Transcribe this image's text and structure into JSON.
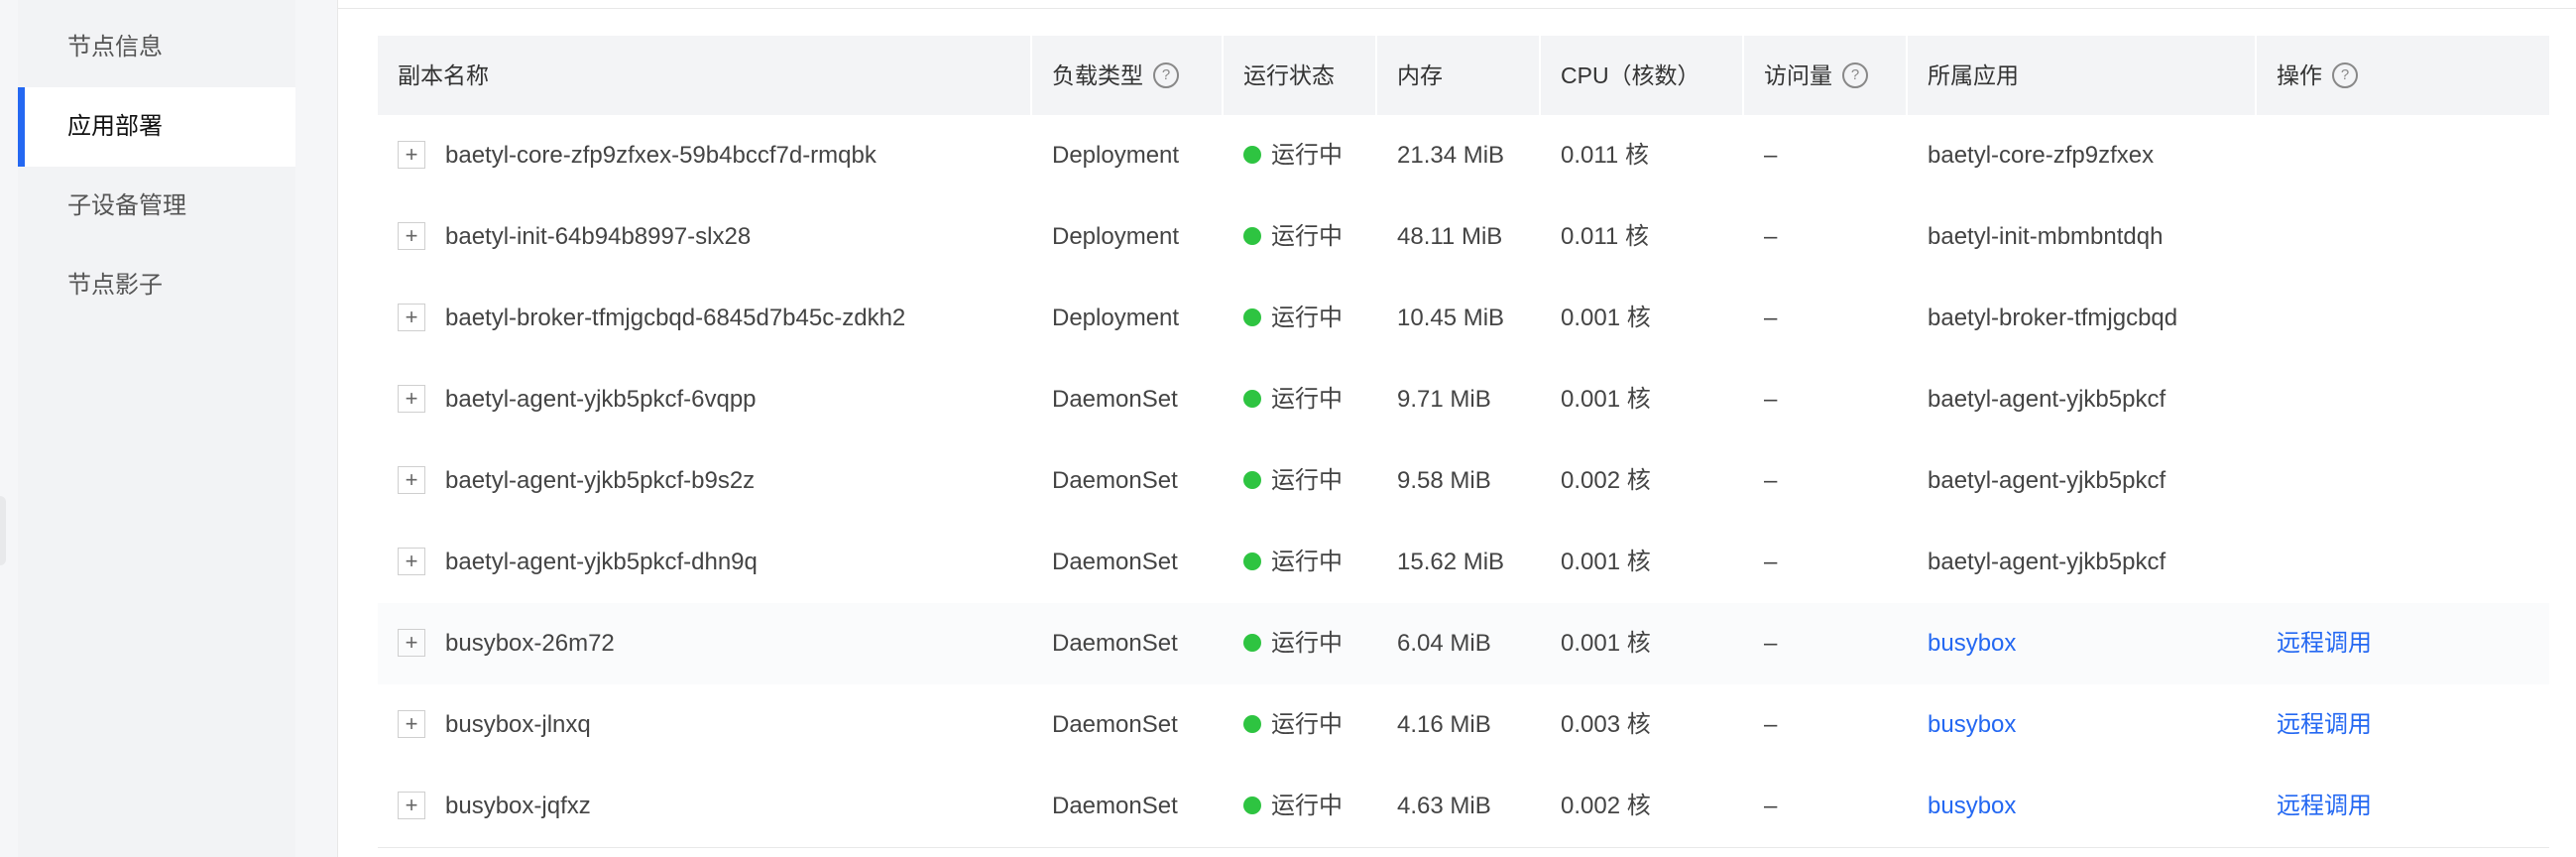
{
  "sidebar": {
    "items": [
      {
        "label": "节点信息",
        "active": false
      },
      {
        "label": "应用部署",
        "active": true
      },
      {
        "label": "子设备管理",
        "active": false
      },
      {
        "label": "节点影子",
        "active": false
      }
    ]
  },
  "table": {
    "headers": {
      "name": "副本名称",
      "workload": "负载类型",
      "status": "运行状态",
      "memory": "内存",
      "cpu": "CPU（核数）",
      "traffic": "访问量",
      "app": "所属应用",
      "actions": "操作"
    },
    "help_glyph": "?",
    "expand_glyph": "+",
    "rows": [
      {
        "name": "baetyl-core-zfp9zfxex-59b4bccf7d-rmqbk",
        "workload": "Deployment",
        "status": "运行中",
        "memory": "21.34 MiB",
        "cpu": "0.011 核",
        "traffic": "–",
        "app": "baetyl-core-zfp9zfxex",
        "app_link": false,
        "action": ""
      },
      {
        "name": "baetyl-init-64b94b8997-slx28",
        "workload": "Deployment",
        "status": "运行中",
        "memory": "48.11 MiB",
        "cpu": "0.011 核",
        "traffic": "–",
        "app": "baetyl-init-mbmbntdqh",
        "app_link": false,
        "action": ""
      },
      {
        "name": "baetyl-broker-tfmjgcbqd-6845d7b45c-zdkh2",
        "workload": "Deployment",
        "status": "运行中",
        "memory": "10.45 MiB",
        "cpu": "0.001 核",
        "traffic": "–",
        "app": "baetyl-broker-tfmjgcbqd",
        "app_link": false,
        "action": ""
      },
      {
        "name": "baetyl-agent-yjkb5pkcf-6vqpp",
        "workload": "DaemonSet",
        "status": "运行中",
        "memory": "9.71 MiB",
        "cpu": "0.001 核",
        "traffic": "–",
        "app": "baetyl-agent-yjkb5pkcf",
        "app_link": false,
        "action": ""
      },
      {
        "name": "baetyl-agent-yjkb5pkcf-b9s2z",
        "workload": "DaemonSet",
        "status": "运行中",
        "memory": "9.58 MiB",
        "cpu": "0.002 核",
        "traffic": "–",
        "app": "baetyl-agent-yjkb5pkcf",
        "app_link": false,
        "action": ""
      },
      {
        "name": "baetyl-agent-yjkb5pkcf-dhn9q",
        "workload": "DaemonSet",
        "status": "运行中",
        "memory": "15.62 MiB",
        "cpu": "0.001 核",
        "traffic": "–",
        "app": "baetyl-agent-yjkb5pkcf",
        "app_link": false,
        "action": ""
      },
      {
        "name": "busybox-26m72",
        "workload": "DaemonSet",
        "status": "运行中",
        "memory": "6.04 MiB",
        "cpu": "0.001 核",
        "traffic": "–",
        "app": "busybox",
        "app_link": true,
        "action": "远程调用"
      },
      {
        "name": "busybox-jlnxq",
        "workload": "DaemonSet",
        "status": "运行中",
        "memory": "4.16 MiB",
        "cpu": "0.003 核",
        "traffic": "–",
        "app": "busybox",
        "app_link": true,
        "action": "远程调用"
      },
      {
        "name": "busybox-jqfxz",
        "workload": "DaemonSet",
        "status": "运行中",
        "memory": "4.63 MiB",
        "cpu": "0.002 核",
        "traffic": "–",
        "app": "busybox",
        "app_link": true,
        "action": "远程调用"
      }
    ]
  },
  "colors": {
    "accent": "#2468f2",
    "status_running": "#2ec441"
  }
}
